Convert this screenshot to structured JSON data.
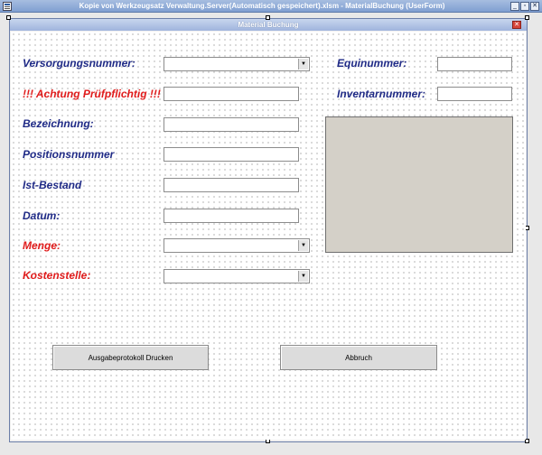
{
  "window": {
    "title": "Kopie von Werkzeugsatz Verwaltung.Server(Automatisch gespeichert).xlsm - MaterialBuchung (UserForm)",
    "controls": {
      "minimize": "_",
      "restore": "▫",
      "close": "✕"
    }
  },
  "form": {
    "title": "Material Buchung",
    "close_symbol": "✕"
  },
  "labels": {
    "versorgungsnummer": "Versorgungsnummer:",
    "achtung": "!!! Achtung Prüfpflichtig !!!",
    "bezeichnung": "Bezeichnung:",
    "positionsnummer": "Positionsnummer",
    "ist_bestand": "Ist-Bestand",
    "datum": "Datum:",
    "menge": "Menge:",
    "kostenstelle": "Kostenstelle:",
    "equinummer": "Equinummer:",
    "inventarnummer": "Inventarnummer:"
  },
  "buttons": {
    "drucken": "Ausgabeprotokoll Drucken",
    "abbruch": "Abbruch"
  },
  "icons": {
    "dropdown": "▼"
  },
  "colors": {
    "label_blue": "#1f2a86",
    "label_red": "#e01b1b",
    "form_title_bg": "#9fb4dd"
  }
}
